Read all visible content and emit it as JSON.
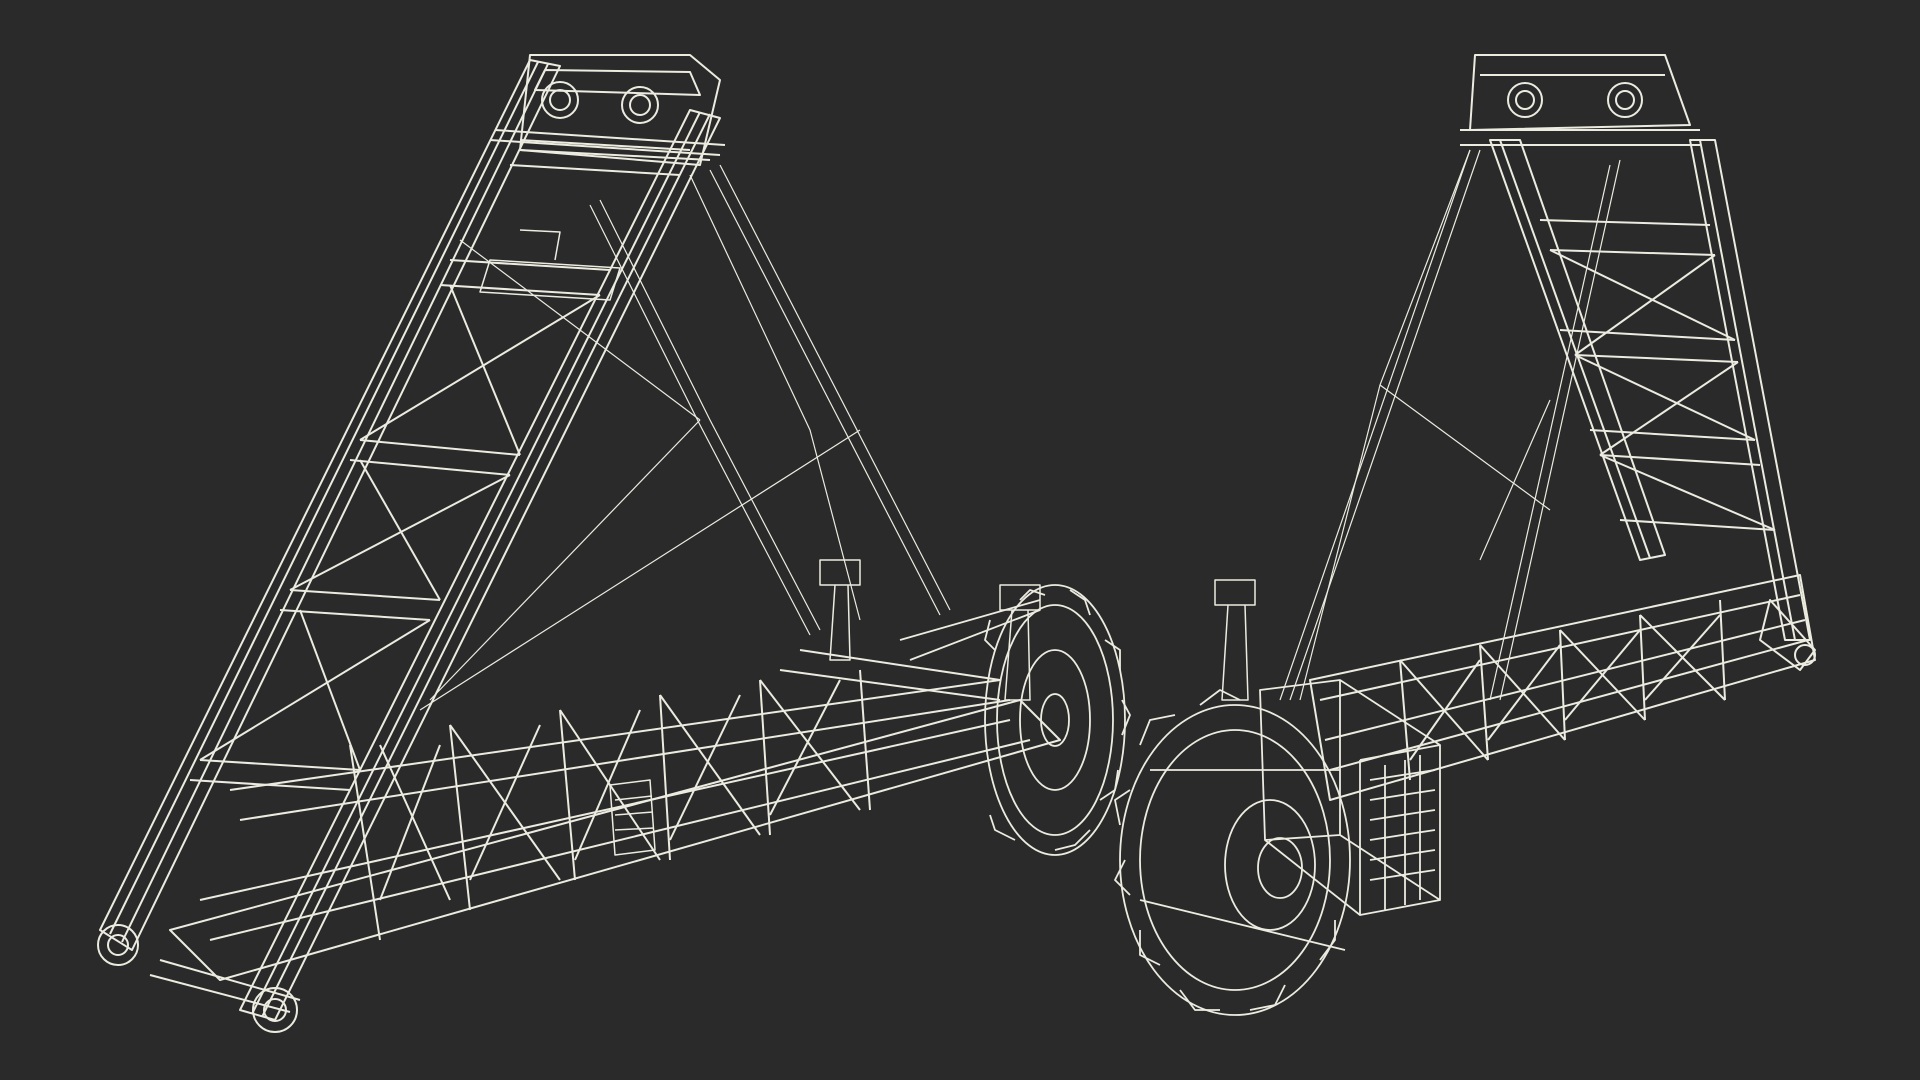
{
  "scene": {
    "background_color": "#2a2a2a",
    "wire_color": "#ecebe0",
    "wire_shadow_color": "#9e9d95",
    "subject": "bucket-wheel-excavator-boom",
    "views": [
      {
        "id": "left-view",
        "description_icon": "boom-wireframe"
      },
      {
        "id": "right-view",
        "description_icon": "boom-wireframe"
      }
    ]
  }
}
